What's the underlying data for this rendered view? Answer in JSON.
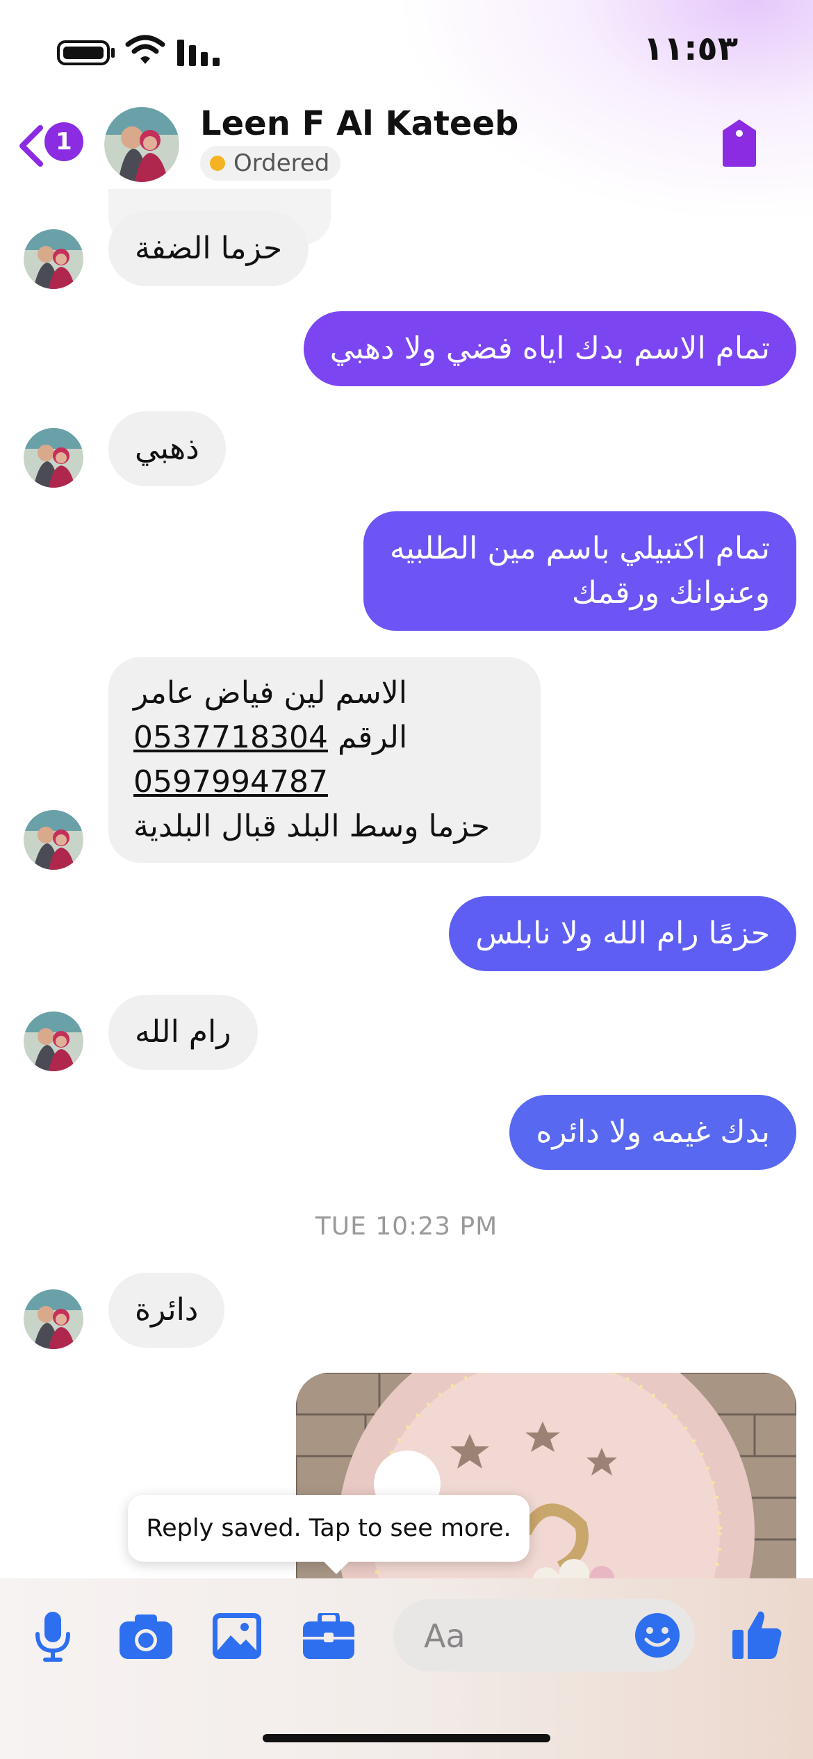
{
  "status_bar": {
    "time": "١١:٥٣"
  },
  "header": {
    "back_badge": "1",
    "contact_name": "Leen F Al Kateeb",
    "status_label": "Ordered"
  },
  "messages": {
    "m1": "حزما الضفة",
    "m2": "تمام الاسم بدك اياه فضي ولا دهبي",
    "m3": "ذهبي",
    "m4_line1": "تمام اكتبيلي باسم مين الطلبيه",
    "m4_line2": "وعنوانك ورقمك",
    "m5_line1": "الاسم لين فياض عامر",
    "m5_line2_label": "الرقم",
    "m5_line2_phone": "0537718304",
    "m5_line3_phone": "0597994787",
    "m5_line4": "حزما وسط البلد قبال البلدية",
    "m6": "حزمًا رام الله ولا نابلس",
    "m7": "رام الله",
    "m8": "بدك غيمه ولا دائره",
    "m9": "دائرة"
  },
  "timestamp": "TUE 10:23 PM",
  "tooltip": "Reply saved. Tap to see more.",
  "composer": {
    "placeholder": "Aa"
  },
  "colors": {
    "accent": "#8b2be2",
    "out_1": "#7b45f2",
    "out_2": "#6c55f4",
    "out_3": "#5f5ef4",
    "out_4": "#5868f1",
    "composer_icons": "#2e6ff0",
    "status_dot": "#f5b324"
  }
}
